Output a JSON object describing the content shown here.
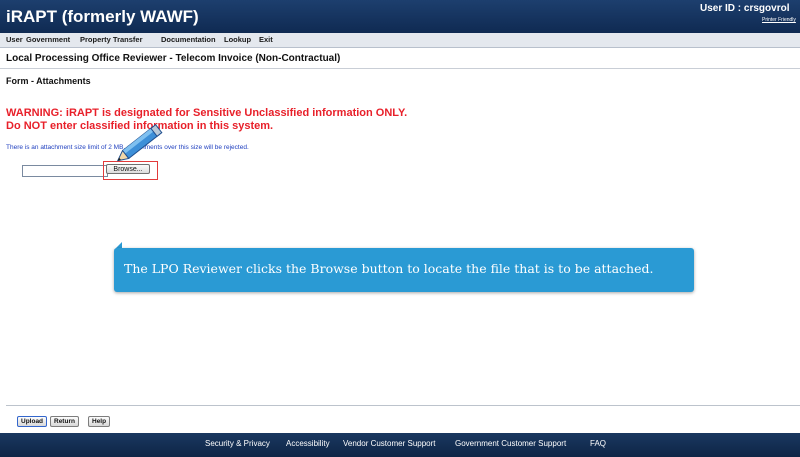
{
  "app": {
    "title": "iRAPT (formerly WAWF)",
    "user_id": "User ID : crsgovrol",
    "printer_friendly": "Printer Friendly"
  },
  "menu": [
    {
      "label": "User"
    },
    {
      "label": "Government"
    },
    {
      "label": "Property Transfer"
    },
    {
      "label": "Documentation"
    },
    {
      "label": "Lookup"
    },
    {
      "label": "Exit"
    }
  ],
  "page": {
    "title": "Local Processing Office Reviewer - Telecom Invoice (Non-Contractual)",
    "form_title": "Form - Attachments",
    "warning_line1": "WARNING: iRAPT is designated for Sensitive Unclassified information ONLY.",
    "warning_line2": "Do NOT enter classified information in this system.",
    "size_note": "There is an attachment size limit of 2 MB, attachments over this size will be rejected."
  },
  "upload": {
    "file_value": "",
    "browse_label": "Browse..."
  },
  "callout": {
    "text": "The LPO Reviewer clicks the Browse button to locate the file that is to be attached."
  },
  "buttons": {
    "upload": "Upload",
    "return": "Return",
    "help": "Help"
  },
  "footer": [
    {
      "label": "Security & Privacy"
    },
    {
      "label": "Accessibility"
    },
    {
      "label": "Vendor Customer Support"
    },
    {
      "label": "Government Customer Support"
    },
    {
      "label": "FAQ"
    }
  ],
  "colors": {
    "header_bg": "#12305a",
    "warning": "#e8202a",
    "callout_bg": "#2a9ad4",
    "highlight": "#e23a3a"
  },
  "icons": [
    "pencil-icon"
  ]
}
